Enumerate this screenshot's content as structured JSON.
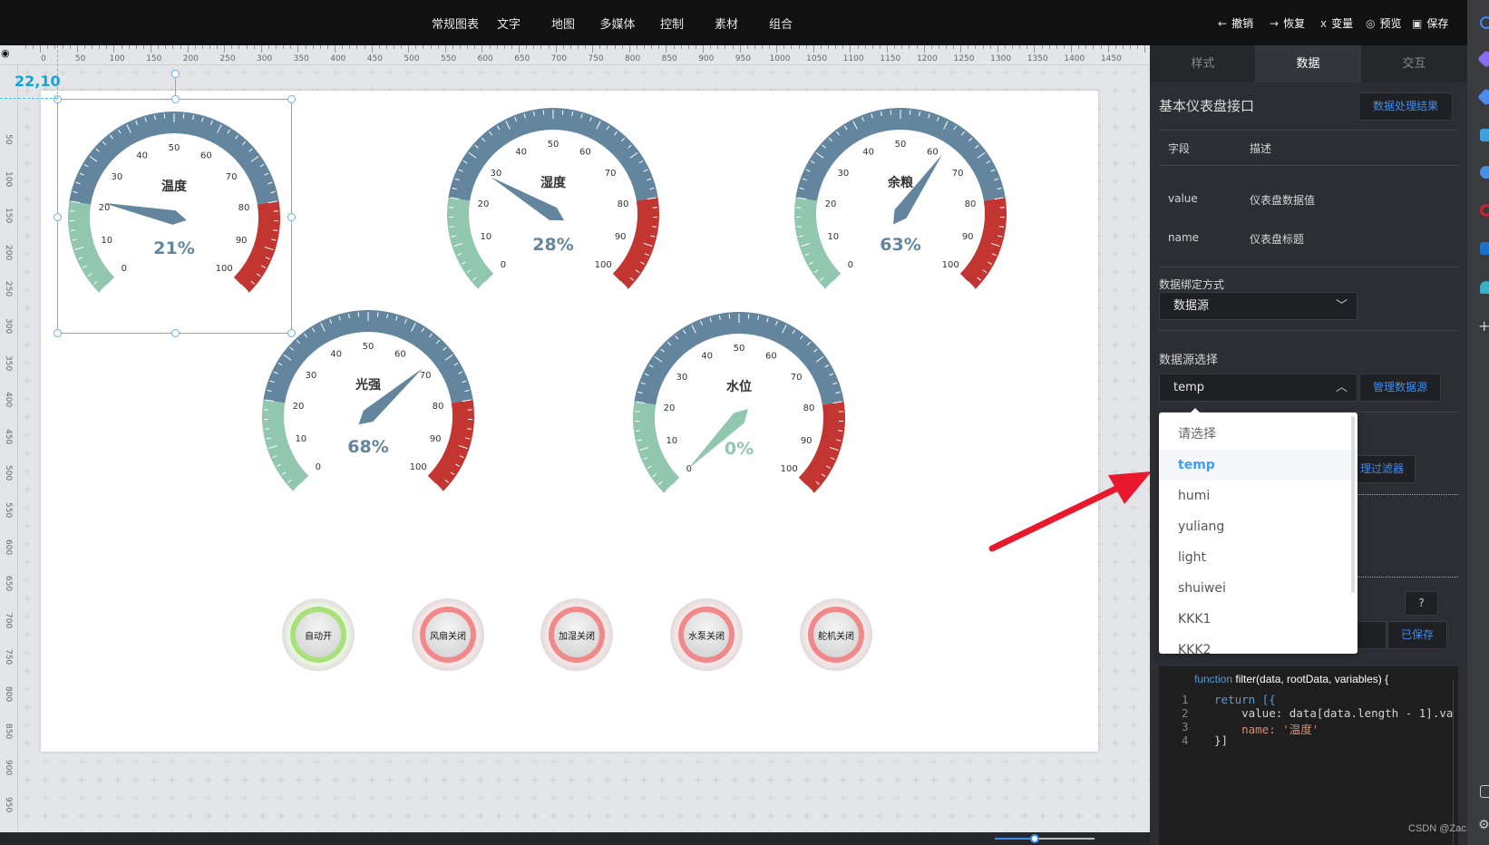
{
  "topbar": {
    "menu": [
      "常规图表",
      "文字",
      "地图",
      "多媒体",
      "控制",
      "素材",
      "组合"
    ],
    "actions": [
      {
        "icon": "undo-arrow-icon",
        "glyph": "←",
        "label": "撤销"
      },
      {
        "icon": "redo-arrow-icon",
        "glyph": "→",
        "label": "恢复"
      },
      {
        "icon": "variable-icon",
        "glyph": "x",
        "label": "变量"
      },
      {
        "icon": "eye-icon",
        "glyph": "◎",
        "label": "预览"
      },
      {
        "icon": "save-icon",
        "glyph": "▣",
        "label": "保存"
      }
    ]
  },
  "ruler": {
    "top": [
      "0",
      "50",
      "100",
      "150",
      "200",
      "250",
      "300",
      "350",
      "400",
      "450",
      "500",
      "550",
      "600",
      "650",
      "700",
      "750",
      "800",
      "850",
      "900",
      "950",
      "1000",
      "1050",
      "1100",
      "1150",
      "1200",
      "1250",
      "1300",
      "1350",
      "1400",
      "1450"
    ],
    "left": [
      "50",
      "100",
      "150",
      "200",
      "250",
      "300",
      "350",
      "400",
      "450",
      "500",
      "550",
      "600",
      "650",
      "700",
      "750",
      "800",
      "850",
      "900",
      "950"
    ]
  },
  "canvas": {
    "selection_coord": "22,10",
    "gauges": [
      {
        "title": "温度",
        "value": 21,
        "unit": "%"
      },
      {
        "title": "湿度",
        "value": 28,
        "unit": "%"
      },
      {
        "title": "余粮",
        "value": 63,
        "unit": "%"
      },
      {
        "title": "光强",
        "value": 68,
        "unit": "%"
      },
      {
        "title": "水位",
        "value": 0,
        "unit": "%"
      }
    ],
    "gauge_colors": {
      "low": "#91c7ae",
      "mid": "#63869e",
      "high": "#c23531"
    },
    "gauge_ticks": [
      "0",
      "10",
      "20",
      "30",
      "40",
      "50",
      "60",
      "70",
      "80",
      "90",
      "100"
    ],
    "buttons": [
      {
        "label": "自动开",
        "state": "on",
        "color": "#a8e07c"
      },
      {
        "label": "风扇关闭",
        "state": "off",
        "color": "#f08a8a"
      },
      {
        "label": "加湿关闭",
        "state": "off",
        "color": "#f08a8a"
      },
      {
        "label": "水泵关闭",
        "state": "off",
        "color": "#f08a8a"
      },
      {
        "label": "舵机关闭",
        "state": "off",
        "color": "#f08a8a"
      }
    ],
    "zoom_slider": 0.4
  },
  "panel": {
    "tabs": [
      "样式",
      "数据",
      "交互"
    ],
    "active_tab": "数据",
    "title": "基本仪表盘接口",
    "result_button": "数据处理结果",
    "fields_header": {
      "field": "字段",
      "desc": "描述"
    },
    "fields": [
      {
        "field": "value",
        "desc": "仪表盘数据值"
      },
      {
        "field": "name",
        "desc": "仪表盘标题"
      }
    ],
    "binding_label": "数据绑定方式",
    "binding_value": "数据源",
    "source_label": "数据源选择",
    "source_value": "temp",
    "manage_source_button": "管理数据源",
    "filter_button_partial": "理过滤器",
    "help_button": "?",
    "saved_button": "已保存",
    "dropdown": {
      "options": [
        "请选择",
        "temp",
        "humi",
        "yuliang",
        "light",
        "shuiwei",
        "KKK1",
        "KKK2"
      ],
      "selected": "temp"
    },
    "code": {
      "signature_kw": "function",
      "signature": " filter(data, rootData, variables) {",
      "lines": [
        {
          "n": "1",
          "text": "return [{"
        },
        {
          "n": "2",
          "text": "    value: data[data.length - 1].va"
        },
        {
          "n": "3",
          "text": "    name: '温度'"
        },
        {
          "n": "4",
          "text": "}]"
        }
      ]
    }
  },
  "watermark": "CSDN @Zac.yi",
  "accent": "#3d8cf0"
}
